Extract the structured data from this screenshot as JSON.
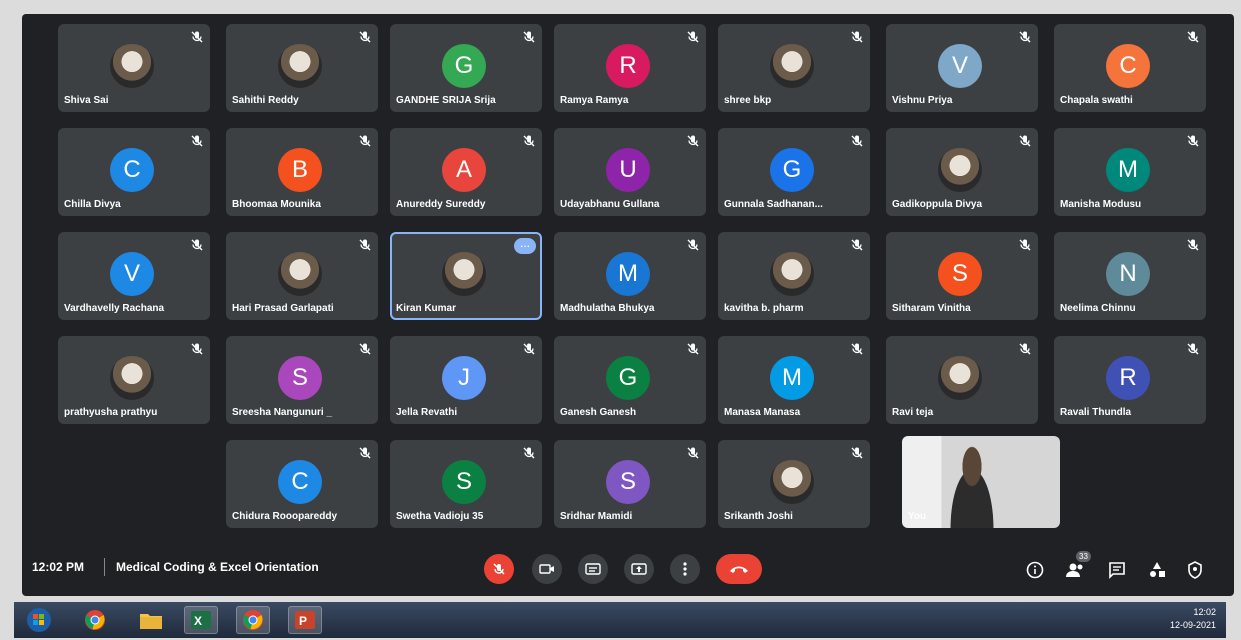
{
  "meeting": {
    "time": "12:02 PM",
    "separator": "|",
    "title": "Medical Coding & Excel Orientation"
  },
  "participants": [
    {
      "name": "Shiva Sai",
      "initial": "",
      "avatar_type": "photo",
      "color": "#6e7f3a"
    },
    {
      "name": "Sahithi Reddy",
      "initial": "",
      "avatar_type": "photo",
      "color": "#5b4a6e"
    },
    {
      "name": "GANDHE SRIJA Srija",
      "initial": "G",
      "avatar_type": "letter",
      "color": "#34a853"
    },
    {
      "name": "Ramya Ramya",
      "initial": "R",
      "avatar_type": "letter",
      "color": "#d81b60"
    },
    {
      "name": "shree bkp",
      "initial": "",
      "avatar_type": "photo",
      "color": "#111111"
    },
    {
      "name": "Vishnu Priya",
      "initial": "V",
      "avatar_type": "letter",
      "color": "#7fa7c8"
    },
    {
      "name": "Chapala swathi",
      "initial": "C",
      "avatar_type": "letter",
      "color": "#f4743b"
    },
    {
      "name": "Chilla Divya",
      "initial": "C",
      "avatar_type": "letter",
      "color": "#1e88e5"
    },
    {
      "name": "Bhoomaa Mounika",
      "initial": "B",
      "avatar_type": "letter",
      "color": "#f4511e"
    },
    {
      "name": "Anureddy Sureddy",
      "initial": "A",
      "avatar_type": "letter",
      "color": "#e8453c"
    },
    {
      "name": "Udayabhanu Gullana",
      "initial": "U",
      "avatar_type": "letter",
      "color": "#8e24aa"
    },
    {
      "name": "Gunnala Sadhanan...",
      "initial": "G",
      "avatar_type": "letter",
      "color": "#1a73e8"
    },
    {
      "name": "Gadikoppula Divya",
      "initial": "",
      "avatar_type": "photo",
      "color": "#a0698f"
    },
    {
      "name": "Manisha Modusu",
      "initial": "M",
      "avatar_type": "letter",
      "color": "#00897b"
    },
    {
      "name": "Vardhavelly Rachana",
      "initial": "V",
      "avatar_type": "letter",
      "color": "#1e88e5"
    },
    {
      "name": "Hari Prasad Garlapati",
      "initial": "",
      "avatar_type": "photo",
      "color": "#6b5f4e"
    },
    {
      "name": "Kiran Kumar",
      "initial": "",
      "avatar_type": "photo",
      "color": "#c3b642",
      "highlight": true
    },
    {
      "name": "Madhulatha Bhukya",
      "initial": "M",
      "avatar_type": "letter",
      "color": "#1976d2"
    },
    {
      "name": "kavitha b. pharm",
      "initial": "",
      "avatar_type": "photo",
      "color": "#8d6e63"
    },
    {
      "name": "Sitharam Vinitha",
      "initial": "S",
      "avatar_type": "letter",
      "color": "#f4511e"
    },
    {
      "name": "Neelima Chinnu",
      "initial": "N",
      "avatar_type": "letter",
      "color": "#5f8a9a"
    },
    {
      "name": "prathyusha prathyu",
      "initial": "",
      "avatar_type": "photo",
      "color": "#444444"
    },
    {
      "name": "Sreesha Nangunuri _",
      "initial": "S",
      "avatar_type": "letter",
      "color": "#ab47bc"
    },
    {
      "name": "Jella Revathi",
      "initial": "J",
      "avatar_type": "letter",
      "color": "#5e97f6"
    },
    {
      "name": "Ganesh Ganesh",
      "initial": "G",
      "avatar_type": "letter",
      "color": "#0b8043"
    },
    {
      "name": "Manasa Manasa",
      "initial": "M",
      "avatar_type": "letter",
      "color": "#039be5"
    },
    {
      "name": "Ravi teja",
      "initial": "",
      "avatar_type": "photo",
      "color": "#b07a3c"
    },
    {
      "name": "Ravali Thundla",
      "initial": "R",
      "avatar_type": "letter",
      "color": "#3f51b5"
    },
    {
      "name": "Chidura Rooopareddy",
      "initial": "C",
      "avatar_type": "letter",
      "color": "#1e88e5"
    },
    {
      "name": "Swetha Vadioju 35",
      "initial": "S",
      "avatar_type": "letter",
      "color": "#0b8043"
    },
    {
      "name": "Sridhar Mamidi",
      "initial": "S",
      "avatar_type": "letter",
      "color": "#7e57c2"
    },
    {
      "name": "Srikanth Joshi",
      "initial": "",
      "avatar_type": "photo",
      "color": "#5d4e42"
    }
  ],
  "self_view": {
    "label": "You"
  },
  "controls": {
    "left": [
      {
        "icon": "mic-off-icon",
        "color": "#ea4335"
      },
      {
        "icon": "camera-icon",
        "color": "#3c4043"
      },
      {
        "icon": "captions-icon",
        "color": "#3c4043"
      },
      {
        "icon": "present-icon",
        "color": "#3c4043"
      },
      {
        "icon": "more-options-icon",
        "color": "#3c4043"
      },
      {
        "icon": "hang-up-icon",
        "color": "#ea4335"
      }
    ],
    "right": [
      {
        "icon": "info-icon"
      },
      {
        "icon": "people-icon",
        "badge": "33"
      },
      {
        "icon": "chat-icon"
      },
      {
        "icon": "activities-icon"
      },
      {
        "icon": "host-controls-icon"
      }
    ]
  },
  "taskbar": {
    "apps": [
      "start-icon",
      "chrome-icon",
      "file-explorer-icon",
      "excel-icon",
      "chrome-icon",
      "powerpoint-icon"
    ],
    "clock_time": "12:02",
    "clock_date": "12-09-2021"
  }
}
